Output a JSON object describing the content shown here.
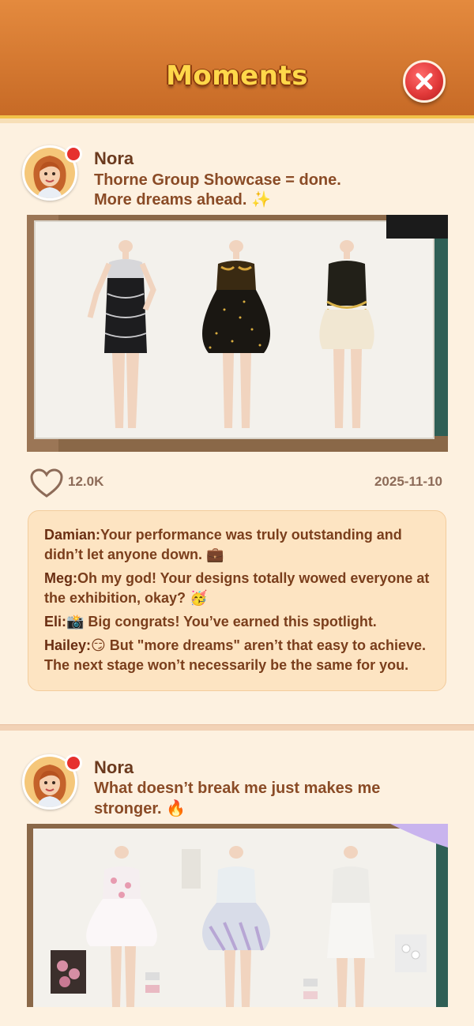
{
  "header": {
    "title": "Moments",
    "close_icon": "close-icon"
  },
  "posts": [
    {
      "author": "Nora",
      "caption_line1": "Thorne Group Showcase = done.",
      "caption_line2": "More dreams ahead. ✨",
      "likes": "12.0K",
      "date": "2025-11-10",
      "comments": [
        {
          "who": "Damian:",
          "text": "Your performance was truly outstanding and didn’t let anyone down. 💼"
        },
        {
          "who": "Meg:",
          "text": "Oh my god! Your designs totally wowed everyone at the exhibition, okay? 🥳"
        },
        {
          "who": "Eli:",
          "text": "📸 Big congrats! You’ve earned this spotlight."
        },
        {
          "who": "Hailey:",
          "text": "😏 But \"more dreams\" aren’t that easy to achieve. The next stage won’t necessarily be the same for you."
        }
      ]
    },
    {
      "author": "Nora",
      "caption_line1": "What doesn’t break me just makes me",
      "caption_line2": "stronger. 🔥"
    }
  ],
  "colors": {
    "header_top": "#e48a3e",
    "header_bottom": "#c76a26",
    "title": "#ffd84a",
    "background": "#fdf1e0",
    "comment_box": "#fde4c2",
    "notification_dot": "#e6312e"
  }
}
